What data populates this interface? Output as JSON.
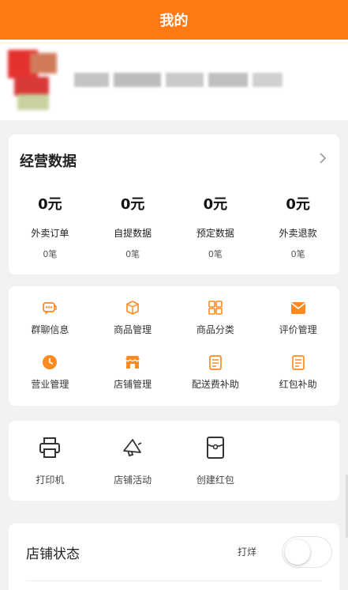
{
  "header": {
    "title": "我的"
  },
  "stats_card": {
    "title": "经营数据",
    "items": [
      {
        "amount": "0元",
        "label": "外卖订单",
        "count": "0笔"
      },
      {
        "amount": "0元",
        "label": "自提数据",
        "count": "0笔"
      },
      {
        "amount": "0元",
        "label": "预定数据",
        "count": "0笔"
      },
      {
        "amount": "0元",
        "label": "外卖退款",
        "count": "0笔"
      }
    ]
  },
  "menu_card": {
    "items": [
      {
        "label": "群聊信息",
        "icon": "group-chat-icon"
      },
      {
        "label": "商品管理",
        "icon": "product-box-icon"
      },
      {
        "label": "商品分类",
        "icon": "category-grid-icon"
      },
      {
        "label": "评价管理",
        "icon": "review-mail-icon"
      },
      {
        "label": "营业管理",
        "icon": "clock-icon"
      },
      {
        "label": "店铺管理",
        "icon": "store-icon"
      },
      {
        "label": "配送费补助",
        "icon": "delivery-subsidy-icon"
      },
      {
        "label": "红包补助",
        "icon": "red-packet-subsidy-icon"
      }
    ]
  },
  "tools_card": {
    "items": [
      {
        "label": "打印机",
        "icon": "printer-icon"
      },
      {
        "label": "店铺活动",
        "icon": "megaphone-icon"
      },
      {
        "label": "创建红包",
        "icon": "create-red-packet-icon"
      }
    ]
  },
  "status_card": {
    "title": "店铺状态",
    "value": "打烊",
    "toggle_on": false
  },
  "colors": {
    "accent": "#ff7a12",
    "icon_orange": "#ff8a1f"
  }
}
